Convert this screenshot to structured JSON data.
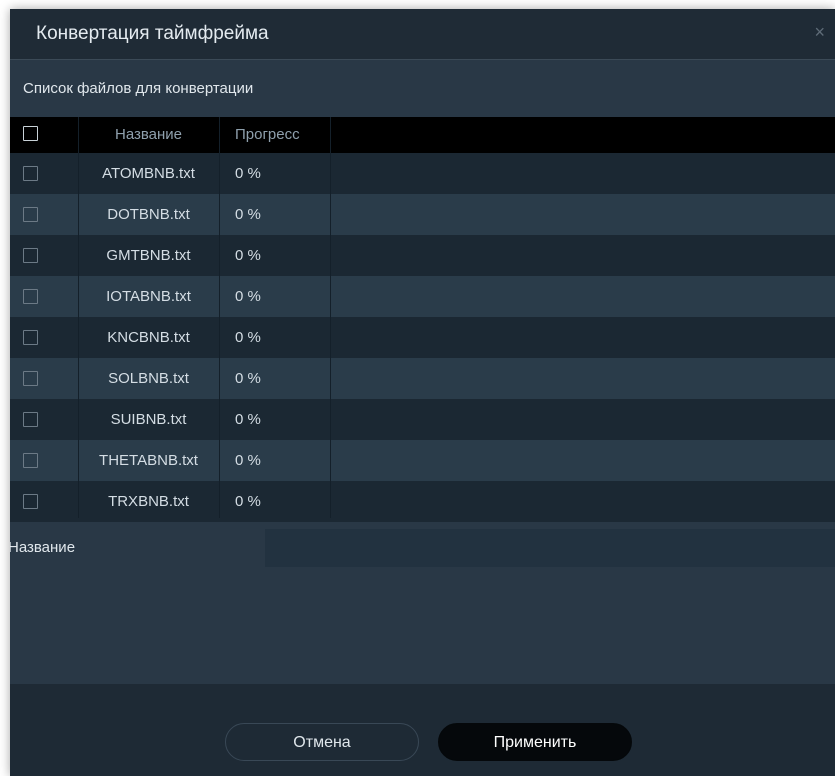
{
  "dialog": {
    "title": "Конвертация таймфрейма",
    "close_icon": "×"
  },
  "files_section": {
    "label": "Список файлов для конвертации"
  },
  "table": {
    "columns": [
      "",
      "Название",
      "Прогресс"
    ],
    "rows": [
      {
        "name": "ATOMBNB.txt",
        "progress": "0 %"
      },
      {
        "name": "DOTBNB.txt",
        "progress": "0 %"
      },
      {
        "name": "GMTBNB.txt",
        "progress": "0 %"
      },
      {
        "name": "IOTABNB.txt",
        "progress": "0 %"
      },
      {
        "name": "KNCBNB.txt",
        "progress": "0 %"
      },
      {
        "name": "SOLBNB.txt",
        "progress": "0 %"
      },
      {
        "name": "SUIBNB.txt",
        "progress": "0 %"
      },
      {
        "name": "THETABNB.txt",
        "progress": "0 %"
      },
      {
        "name": "TRXBNB.txt",
        "progress": "0 %"
      }
    ]
  },
  "name_field": {
    "label": "Название",
    "value": "",
    "placeholder": ""
  },
  "buttons": {
    "cancel": "Отмена",
    "apply": "Применить"
  },
  "colors": {
    "dialog_bg": "#293846",
    "titlebar_bg": "#1f2b36",
    "header_bg": "#000000",
    "row_dark": "#1b2833",
    "row_light": "#2a3c4a",
    "apply_bg": "#05080b"
  }
}
